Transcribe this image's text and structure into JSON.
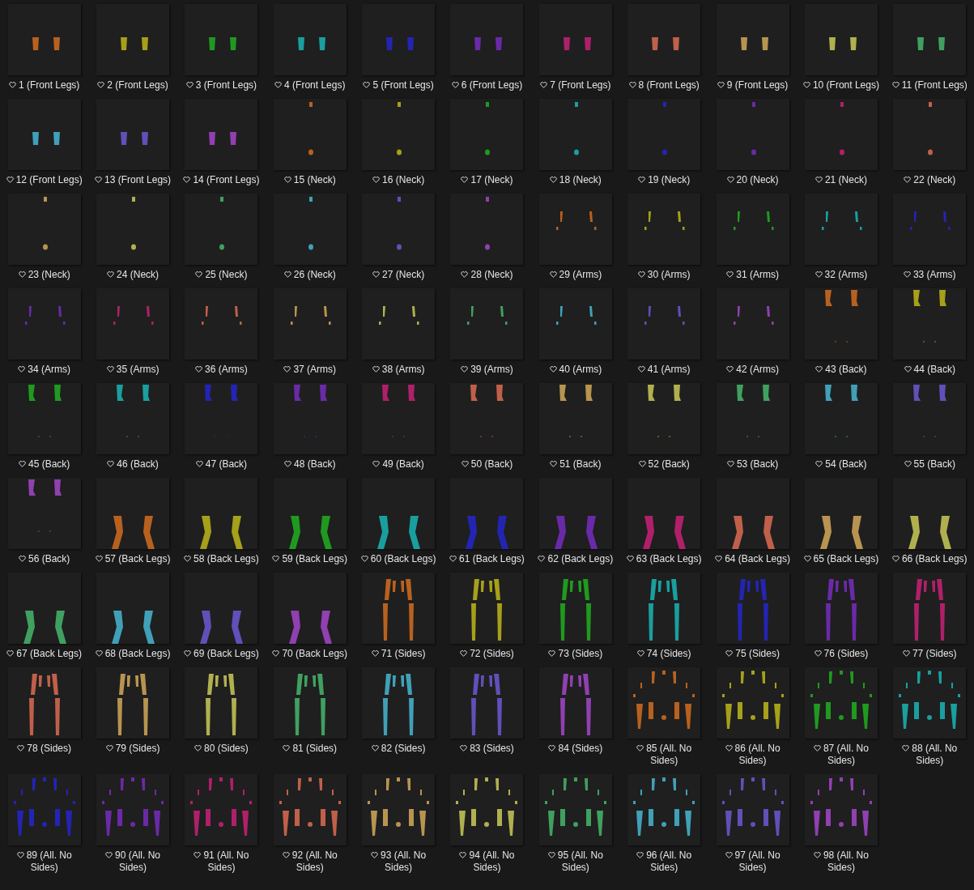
{
  "files": [
    {
      "label": "1 (Front Legs)",
      "kind": "front_legs",
      "color": "#b8611f"
    },
    {
      "label": "2 (Front Legs)",
      "kind": "front_legs",
      "color": "#a6a01a"
    },
    {
      "label": "3 (Front Legs)",
      "kind": "front_legs",
      "color": "#1f9a1f"
    },
    {
      "label": "4 (Front Legs)",
      "kind": "front_legs",
      "color": "#1a9e9e"
    },
    {
      "label": "5 (Front Legs)",
      "kind": "front_legs",
      "color": "#2424b4"
    },
    {
      "label": "6 (Front Legs)",
      "kind": "front_legs",
      "color": "#6a2aa8"
    },
    {
      "label": "7 (Front Legs)",
      "kind": "front_legs",
      "color": "#b0206a"
    },
    {
      "label": "8 (Front Legs)",
      "kind": "front_legs",
      "color": "#c0604a"
    },
    {
      "label": "9 (Front Legs)",
      "kind": "front_legs",
      "color": "#b89450"
    },
    {
      "label": "10 (Front Legs)",
      "kind": "front_legs",
      "color": "#b0b050"
    },
    {
      "label": "11 (Front Legs)",
      "kind": "front_legs",
      "color": "#40a060"
    },
    {
      "label": "12 (Front Legs)",
      "kind": "front_legs",
      "color": "#40a0b8"
    },
    {
      "label": "13 (Front Legs)",
      "kind": "front_legs",
      "color": "#6050b8"
    },
    {
      "label": "14 (Front Legs)",
      "kind": "front_legs",
      "color": "#9040b0"
    },
    {
      "label": "15 (Neck)",
      "kind": "neck",
      "color": "#b8611f"
    },
    {
      "label": "16 (Neck)",
      "kind": "neck",
      "color": "#a6a01a"
    },
    {
      "label": "17 (Neck)",
      "kind": "neck",
      "color": "#1f9a1f"
    },
    {
      "label": "18 (Neck)",
      "kind": "neck",
      "color": "#1a9e9e"
    },
    {
      "label": "19 (Neck)",
      "kind": "neck",
      "color": "#2424b4"
    },
    {
      "label": "20 (Neck)",
      "kind": "neck",
      "color": "#6a2aa8"
    },
    {
      "label": "21 (Neck)",
      "kind": "neck",
      "color": "#b0206a"
    },
    {
      "label": "22 (Neck)",
      "kind": "neck",
      "color": "#c0604a"
    },
    {
      "label": "23 (Neck)",
      "kind": "neck",
      "color": "#b89450"
    },
    {
      "label": "24 (Neck)",
      "kind": "neck",
      "color": "#b0b050"
    },
    {
      "label": "25 (Neck)",
      "kind": "neck",
      "color": "#40a060"
    },
    {
      "label": "26 (Neck)",
      "kind": "neck",
      "color": "#40a0b8"
    },
    {
      "label": "27 (Neck)",
      "kind": "neck",
      "color": "#6050b8"
    },
    {
      "label": "28 (Neck)",
      "kind": "neck",
      "color": "#9040b0"
    },
    {
      "label": "29 (Arms)",
      "kind": "arms",
      "color": "#b8611f"
    },
    {
      "label": "30 (Arms)",
      "kind": "arms",
      "color": "#a6a01a"
    },
    {
      "label": "31 (Arms)",
      "kind": "arms",
      "color": "#1f9a1f"
    },
    {
      "label": "32 (Arms)",
      "kind": "arms",
      "color": "#1a9e9e"
    },
    {
      "label": "33 (Arms)",
      "kind": "arms",
      "color": "#2424b4"
    },
    {
      "label": "34 (Arms)",
      "kind": "arms",
      "color": "#6a2aa8"
    },
    {
      "label": "35 (Arms)",
      "kind": "arms",
      "color": "#b0206a"
    },
    {
      "label": "36 (Arms)",
      "kind": "arms",
      "color": "#c0604a"
    },
    {
      "label": "37 (Arms)",
      "kind": "arms",
      "color": "#b89450"
    },
    {
      "label": "38 (Arms)",
      "kind": "arms",
      "color": "#b0b050"
    },
    {
      "label": "39 (Arms)",
      "kind": "arms",
      "color": "#40a060"
    },
    {
      "label": "40 (Arms)",
      "kind": "arms",
      "color": "#40a0b8"
    },
    {
      "label": "41 (Arms)",
      "kind": "arms",
      "color": "#6050b8"
    },
    {
      "label": "42 (Arms)",
      "kind": "arms",
      "color": "#9040b0"
    },
    {
      "label": "43 (Back)",
      "kind": "back",
      "color": "#b8611f"
    },
    {
      "label": "44 (Back)",
      "kind": "back",
      "color": "#a6a01a"
    },
    {
      "label": "45 (Back)",
      "kind": "back",
      "color": "#1f9a1f"
    },
    {
      "label": "46 (Back)",
      "kind": "back",
      "color": "#1a9e9e"
    },
    {
      "label": "47 (Back)",
      "kind": "back",
      "color": "#2424b4"
    },
    {
      "label": "48 (Back)",
      "kind": "back",
      "color": "#6a2aa8"
    },
    {
      "label": "49 (Back)",
      "kind": "back",
      "color": "#b0206a"
    },
    {
      "label": "50 (Back)",
      "kind": "back",
      "color": "#c0604a"
    },
    {
      "label": "51 (Back)",
      "kind": "back",
      "color": "#b89450"
    },
    {
      "label": "52 (Back)",
      "kind": "back",
      "color": "#b0b050"
    },
    {
      "label": "53 (Back)",
      "kind": "back",
      "color": "#40a060"
    },
    {
      "label": "54 (Back)",
      "kind": "back",
      "color": "#40a0b8"
    },
    {
      "label": "55 (Back)",
      "kind": "back",
      "color": "#6050b8"
    },
    {
      "label": "56 (Back)",
      "kind": "back",
      "color": "#9040b0"
    },
    {
      "label": "57 (Back Legs)",
      "kind": "back_legs",
      "color": "#b8611f"
    },
    {
      "label": "58 (Back Legs)",
      "kind": "back_legs",
      "color": "#a6a01a"
    },
    {
      "label": "59 (Back Legs)",
      "kind": "back_legs",
      "color": "#1f9a1f"
    },
    {
      "label": "60 (Back Legs)",
      "kind": "back_legs",
      "color": "#1a9e9e"
    },
    {
      "label": "61 (Back Legs)",
      "kind": "back_legs",
      "color": "#2424b4"
    },
    {
      "label": "62 (Back Legs)",
      "kind": "back_legs",
      "color": "#6a2aa8"
    },
    {
      "label": "63 (Back Legs)",
      "kind": "back_legs",
      "color": "#b0206a"
    },
    {
      "label": "64 (Back Legs)",
      "kind": "back_legs",
      "color": "#c0604a"
    },
    {
      "label": "65 (Back Legs)",
      "kind": "back_legs",
      "color": "#b89450"
    },
    {
      "label": "66 (Back Legs)",
      "kind": "back_legs",
      "color": "#b0b050"
    },
    {
      "label": "67 (Back Legs)",
      "kind": "back_legs",
      "color": "#40a060"
    },
    {
      "label": "68 (Back Legs)",
      "kind": "back_legs",
      "color": "#40a0b8"
    },
    {
      "label": "69 (Back Legs)",
      "kind": "back_legs",
      "color": "#6050b8"
    },
    {
      "label": "70 (Back Legs)",
      "kind": "back_legs",
      "color": "#9040b0"
    },
    {
      "label": "71 (Sides)",
      "kind": "sides",
      "color": "#b8611f"
    },
    {
      "label": "72 (Sides)",
      "kind": "sides",
      "color": "#a6a01a"
    },
    {
      "label": "73 (Sides)",
      "kind": "sides",
      "color": "#1f9a1f"
    },
    {
      "label": "74 (Sides)",
      "kind": "sides",
      "color": "#1a9e9e"
    },
    {
      "label": "75 (Sides)",
      "kind": "sides",
      "color": "#2424b4"
    },
    {
      "label": "76 (Sides)",
      "kind": "sides",
      "color": "#6a2aa8"
    },
    {
      "label": "77 (Sides)",
      "kind": "sides",
      "color": "#b0206a"
    },
    {
      "label": "78 (Sides)",
      "kind": "sides",
      "color": "#c0604a"
    },
    {
      "label": "79 (Sides)",
      "kind": "sides",
      "color": "#b89450"
    },
    {
      "label": "80 (Sides)",
      "kind": "sides",
      "color": "#b0b050"
    },
    {
      "label": "81 (Sides)",
      "kind": "sides",
      "color": "#40a060"
    },
    {
      "label": "82 (Sides)",
      "kind": "sides",
      "color": "#40a0b8"
    },
    {
      "label": "83 (Sides)",
      "kind": "sides",
      "color": "#6050b8"
    },
    {
      "label": "84 (Sides)",
      "kind": "sides",
      "color": "#9040b0"
    },
    {
      "label": "85 (All. No Sides)",
      "kind": "all",
      "color": "#b8611f"
    },
    {
      "label": "86 (All. No Sides)",
      "kind": "all",
      "color": "#a6a01a"
    },
    {
      "label": "87 (All. No Sides)",
      "kind": "all",
      "color": "#1f9a1f"
    },
    {
      "label": "88 (All. No Sides)",
      "kind": "all",
      "color": "#1a9e9e"
    },
    {
      "label": "89 (All. No Sides)",
      "kind": "all",
      "color": "#2424b4"
    },
    {
      "label": "90 (All. No Sides)",
      "kind": "all",
      "color": "#6a2aa8"
    },
    {
      "label": "91 (All. No Sides)",
      "kind": "all",
      "color": "#b0206a"
    },
    {
      "label": "92 (All. No Sides)",
      "kind": "all",
      "color": "#c0604a"
    },
    {
      "label": "93 (All. No Sides)",
      "kind": "all",
      "color": "#b89450"
    },
    {
      "label": "94 (All. No Sides)",
      "kind": "all",
      "color": "#b0b050"
    },
    {
      "label": "95 (All. No Sides)",
      "kind": "all",
      "color": "#40a060"
    },
    {
      "label": "96 (All. No Sides)",
      "kind": "all",
      "color": "#40a0b8"
    },
    {
      "label": "97 (All. No Sides)",
      "kind": "all",
      "color": "#6050b8"
    },
    {
      "label": "98 (All. No Sides)",
      "kind": "all",
      "color": "#9040b0"
    }
  ]
}
